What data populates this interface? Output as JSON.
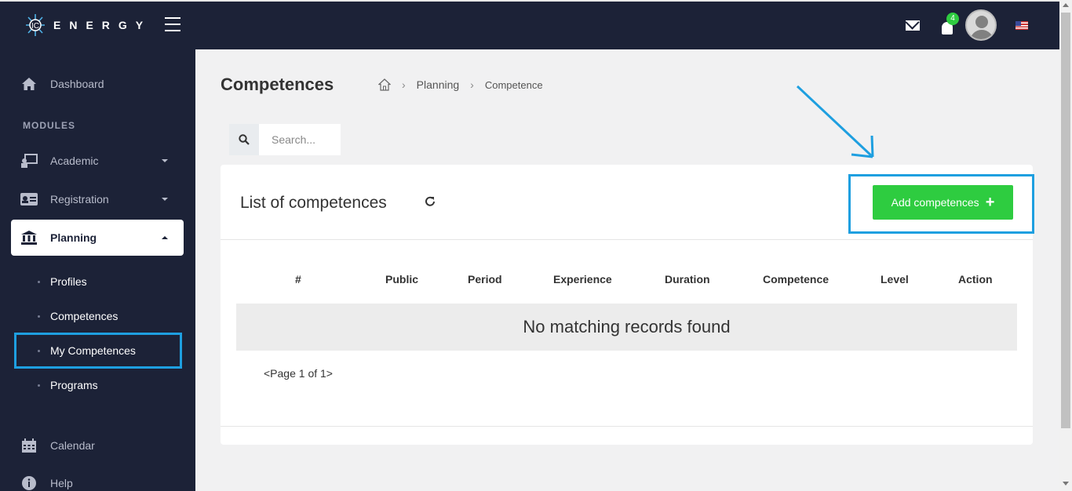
{
  "brand": {
    "name": "ENERGY"
  },
  "header": {
    "notification_count": "4"
  },
  "sidebar": {
    "dashboard": "Dashboard",
    "modules_label": "MODULES",
    "academic": "Academic",
    "registration": "Registration",
    "planning": "Planning",
    "sub_items": [
      "Profiles",
      "Competences",
      "My Competences",
      "Programs"
    ],
    "calendar": "Calendar",
    "help": "Help"
  },
  "page": {
    "title": "Competences",
    "breadcrumb": [
      "Planning",
      "Competence"
    ]
  },
  "search": {
    "placeholder": "Search..."
  },
  "card": {
    "title": "List of competences",
    "add_button": "Add competences",
    "columns": [
      "#",
      "Public",
      "Period",
      "Experience",
      "Duration",
      "Competence",
      "Level",
      "Action"
    ],
    "empty_message": "No matching records found",
    "pager": "<Page 1 of 1>"
  },
  "colors": {
    "sidebar_bg": "#1c2237",
    "accent_green": "#2ecc40",
    "annotation_blue": "#1e9fe0"
  }
}
